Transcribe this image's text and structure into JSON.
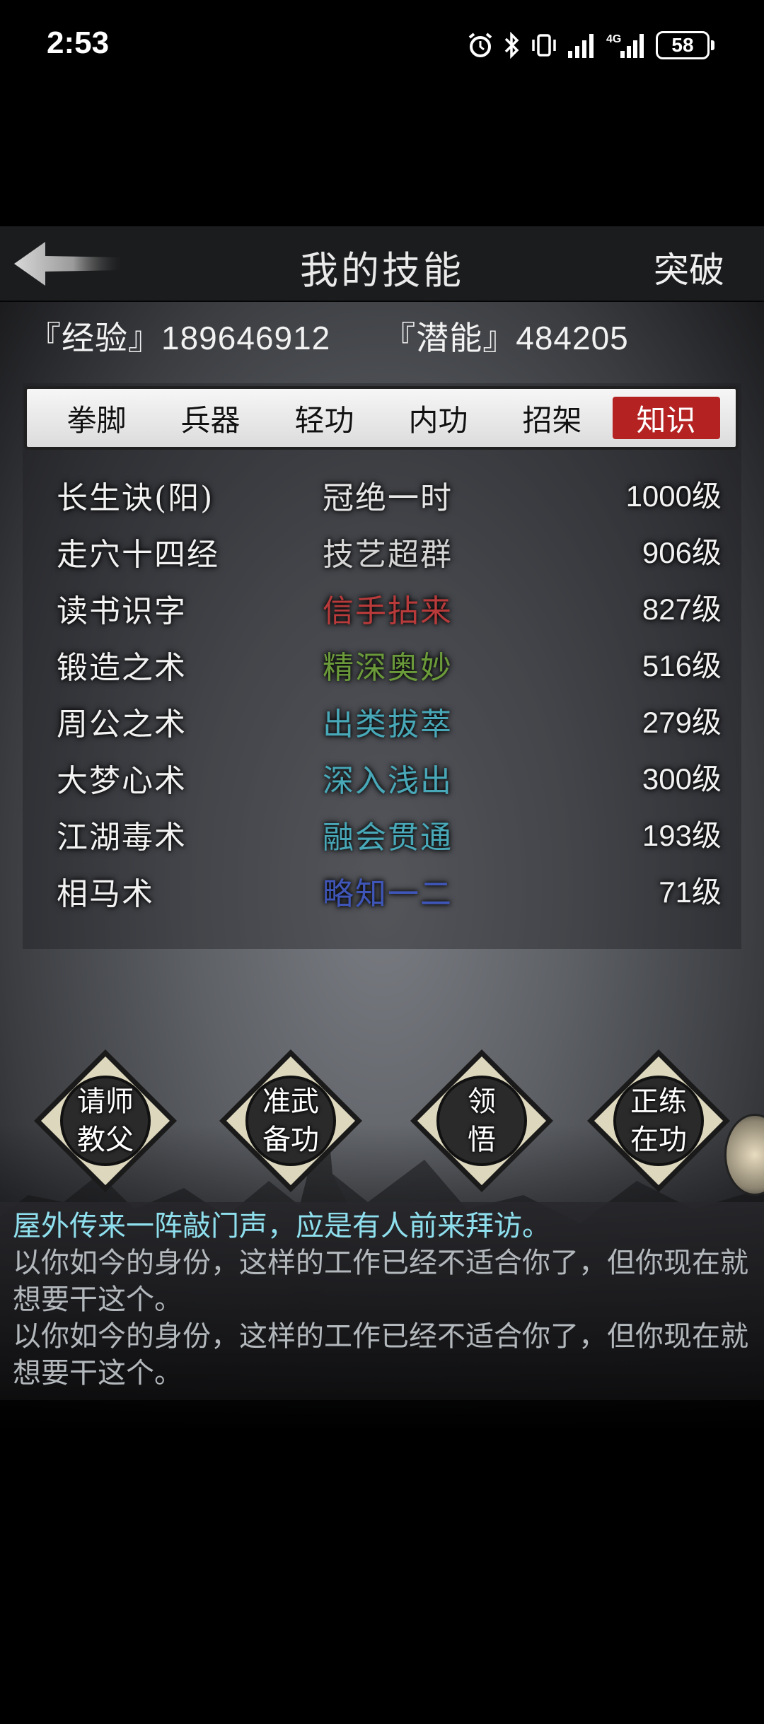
{
  "status_bar": {
    "time": "2:53",
    "battery": "58",
    "icons": [
      "alarm-icon",
      "bluetooth-icon",
      "vibrate-icon",
      "signal-icon",
      "4g-signal-icon",
      "battery-icon"
    ]
  },
  "header": {
    "title": "我的技能",
    "action": "突破",
    "back_icon": "back-arrow-icon"
  },
  "stats": {
    "exp_label": "『经验』",
    "exp_value": "189646912",
    "potential_label": "『潜能』",
    "potential_value": "484205"
  },
  "tabs": [
    {
      "label": "拳脚",
      "active": false
    },
    {
      "label": "兵器",
      "active": false
    },
    {
      "label": "轻功",
      "active": false
    },
    {
      "label": "内功",
      "active": false
    },
    {
      "label": "招架",
      "active": false
    },
    {
      "label": "知识",
      "active": true
    }
  ],
  "skills": [
    {
      "name": "长生诀(阳)",
      "rank": "冠绝一时",
      "rank_color": "#e6e6e6",
      "level": "1000级"
    },
    {
      "name": "走穴十四经",
      "rank": "技艺超群",
      "rank_color": "#d4d4d4",
      "level": "906级"
    },
    {
      "name": "读书识字",
      "rank": "信手拈来",
      "rank_color": "#b83a3a",
      "level": "827级"
    },
    {
      "name": "锻造之术",
      "rank": "精深奥妙",
      "rank_color": "#6b9a3a",
      "level": "516级"
    },
    {
      "name": "周公之术",
      "rank": "出类拔萃",
      "rank_color": "#48a8b8",
      "level": "279级"
    },
    {
      "name": "大梦心术",
      "rank": "深入浅出",
      "rank_color": "#48a8b8",
      "level": "300级"
    },
    {
      "name": "江湖毒术",
      "rank": "融会贯通",
      "rank_color": "#48a8b8",
      "level": "193级"
    },
    {
      "name": "相马术",
      "rank": "略知一二",
      "rank_color": "#3f56b8",
      "level": "71级"
    }
  ],
  "actions": [
    {
      "line1": "请师",
      "line2": "教父"
    },
    {
      "line1": "准武",
      "line2": "备功"
    },
    {
      "line1": "领",
      "line2": "悟"
    },
    {
      "line1": "正练",
      "line2": "在功"
    }
  ],
  "messages": [
    {
      "text": "屋外传来一阵敲门声，应是有人前来拜访。",
      "color": "cyan"
    },
    {
      "text": "以你如今的身份，这样的工作已经不适合你了，但你现在就想要干这个。",
      "color": "grey"
    },
    {
      "text": "以你如今的身份，这样的工作已经不适合你了，但你现在就想要干这个。",
      "color": "grey"
    }
  ]
}
